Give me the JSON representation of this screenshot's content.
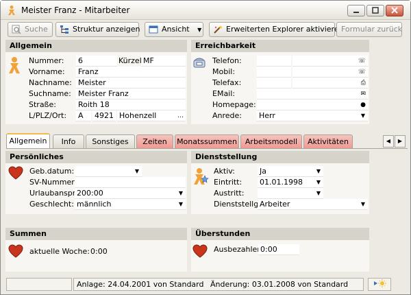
{
  "window": {
    "title": "Meister Franz - Mitarbeiter"
  },
  "toolbar": {
    "suche": "Suche",
    "struktur": "Struktur anzeigen",
    "ansicht": "Ansicht",
    "explorer": "Erweiterten Explorer aktivieren",
    "formular_zurueck": "Formular zurück"
  },
  "allgemein": {
    "title": "Allgemein",
    "nummer_label": "Nummer:",
    "nummer": "6",
    "kuerzel_label": "Kürzel:",
    "kuerzel": "MF",
    "vorname_label": "Vorname:",
    "vorname": "Franz",
    "nachname_label": "Nachname:",
    "nachname": "Meister",
    "suchname_label": "Suchname:",
    "suchname": "Meister Franz",
    "strasse_label": "Straße:",
    "strasse": "Roith 18",
    "ort_label": "L/PLZ/Ort:",
    "land": "A",
    "plz": "4921",
    "ort": "Hohenzell"
  },
  "erreichbarkeit": {
    "title": "Erreichbarkeit",
    "telefon_label": "Telefon:",
    "mobil_label": "Mobil:",
    "telefax_label": "Telefax:",
    "email_label": "EMail:",
    "homepage_label": "Homepage:",
    "anrede_label": "Anrede:",
    "anrede": "Herr"
  },
  "tabs": [
    "Allgemein",
    "Info",
    "Sonstiges",
    "Zeiten",
    "Monatssummen",
    "Arbeitsmodell",
    "Aktivitäten"
  ],
  "persoenliches": {
    "title": "Persönliches",
    "geb_label": "Geb.datum:",
    "sv_label": "SV-Nummer:",
    "urlaub_label": "Urlaubanspr:",
    "urlaub": "200:00",
    "geschlecht_label": "Geschlecht:",
    "geschlecht": "männlich"
  },
  "dienststellung": {
    "title": "Dienststellung",
    "aktiv_label": "Aktiv:",
    "aktiv": "Ja",
    "eintritt_label": "Eintritt:",
    "eintritt": "01.01.1998",
    "austritt_label": "Austritt:",
    "dienststellg_label": "Dienststellg:",
    "dienststellg": "Arbeiter"
  },
  "summen": {
    "title": "Summen",
    "woche_label": "aktuelle Woche:",
    "woche": "0:00"
  },
  "ueberstunden": {
    "title": "Überstunden",
    "ausbezahlen_label": "Ausbezahlen:",
    "ausbezahlen": "0:00"
  },
  "status": {
    "anlage": "Anlage: 24.04.2001 von Standard",
    "aenderung": "Änderung: 03.01.2008 von Standard"
  },
  "colors": {
    "tab_red": "#ee9a92",
    "header_bg": "#d6d3ca",
    "active_tab_accent": "#f2b94f"
  }
}
